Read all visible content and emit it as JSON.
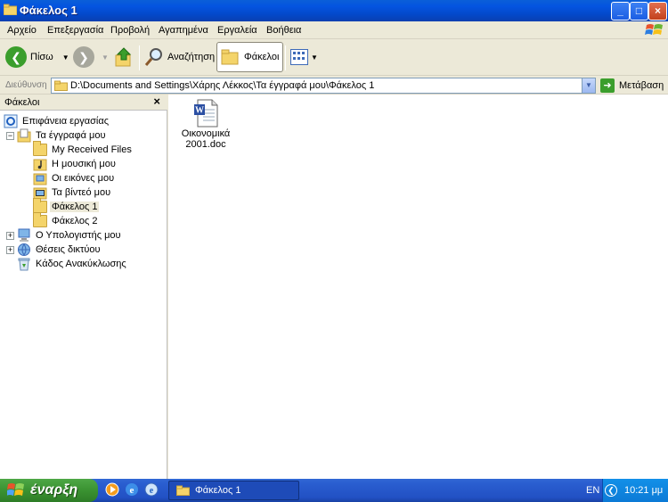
{
  "window": {
    "title": "Φάκελος 1",
    "buttons": {
      "minimize": "_",
      "maximize": "□",
      "close": "×"
    }
  },
  "menu": [
    "Αρχείο",
    "Επεξεργασία",
    "Προβολή",
    "Αγαπημένα",
    "Εργαλεία",
    "Βοήθεια"
  ],
  "toolbar": {
    "back_label": "Πίσω",
    "search_label": "Αναζήτηση",
    "folders_label": "Φάκελοι"
  },
  "address": {
    "label": "Διεύθυνση",
    "path": "D:\\Documents and Settings\\Χάρης Λέκκος\\Τα έγγραφά μου\\Φάκελος 1",
    "go_label": "Μετάβαση"
  },
  "folders_pane": {
    "title": "Φάκελοι",
    "close": "×",
    "tree": {
      "desktop": "Επιφάνεια εργασίας",
      "my_documents": "Τα έγγραφά μου",
      "my_received_files": "My Received Files",
      "my_music": "Η μουσική μου",
      "my_pictures": "Οι εικόνες μου",
      "my_videos": "Τα βίντεό μου",
      "folder1": "Φάκελος 1",
      "folder2": "Φάκελος 2",
      "my_computer": "Ο Υπολογιστής μου",
      "network_places": "Θέσεις δικτύου",
      "recycle_bin": "Κάδος Ανακύκλωσης"
    }
  },
  "files": [
    {
      "name_line1": "Οικονομικά",
      "name_line2": "2001.doc",
      "icon": "word-document-icon"
    }
  ],
  "taskbar": {
    "start_label": "έναρξη",
    "task_label": "Φάκελος 1",
    "language": "EN",
    "clock": "10:21 μμ"
  },
  "colors": {
    "titlebar": "#0454e0",
    "taskbar": "#2a5ed0",
    "start": "#3a9231",
    "tray": "#0c7ad6"
  }
}
